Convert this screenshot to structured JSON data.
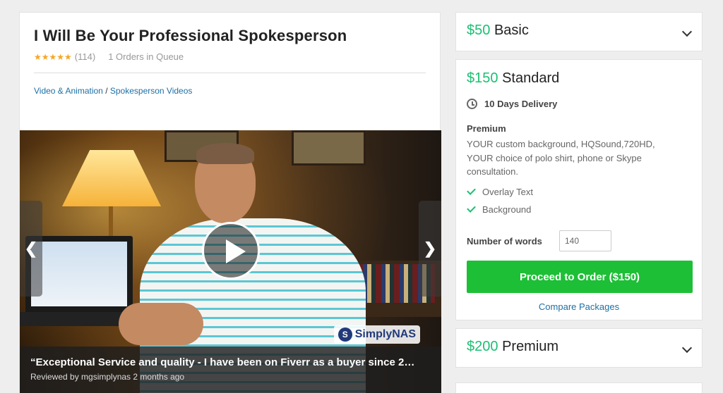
{
  "gig": {
    "title": "I Will Be Your Professional Spokesperson",
    "stars": "★★★★★",
    "review_count": "(114)",
    "queue": "1 Orders in Queue",
    "breadcrumb": {
      "category": "Video & Animation",
      "separator": " / ",
      "subcategory": "Spokesperson Videos"
    }
  },
  "video": {
    "watermark": "SimplyNAS",
    "watermark_logo": "S",
    "prev_icon": "❮",
    "next_icon": "❯",
    "review_quote": "“Exceptional Service and quality - I have been on Fiverr as a buyer since 2…",
    "review_meta": "Reviewed by mgsimplynas 2 months ago"
  },
  "packages": {
    "basic": {
      "price": "$50",
      "name": "Basic"
    },
    "standard": {
      "price": "$150",
      "name": "Standard",
      "delivery": "10 Days Delivery",
      "desc_title": "Premium",
      "description": "YOUR custom background, HQSound,720HD, YOUR choice of polo shirt, phone or Skype consultation.",
      "features": [
        "Overlay Text",
        "Background"
      ],
      "words_label": "Number of words",
      "words_value": "140",
      "order_button": "Proceed to Order ($150)",
      "compare_link": "Compare Packages"
    },
    "premium": {
      "price": "$200",
      "name": "Premium"
    }
  },
  "colors": {
    "accent_green": "#1dbf73",
    "button_green": "#1dbf36",
    "link_blue": "#1d6fa5"
  }
}
